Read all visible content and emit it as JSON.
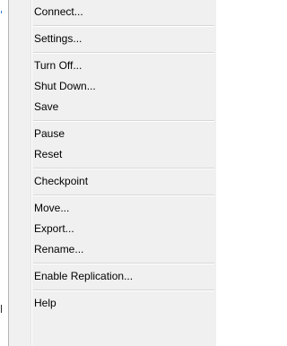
{
  "menu": {
    "groups": [
      [
        "Connect..."
      ],
      [
        "Settings..."
      ],
      [
        "Turn Off...",
        "Shut Down...",
        "Save"
      ],
      [
        "Pause",
        "Reset"
      ],
      [
        "Checkpoint"
      ],
      [
        "Move...",
        "Export...",
        "Rename..."
      ],
      [
        "Enable Replication..."
      ],
      [
        "Help"
      ]
    ],
    "items": {
      "connect": "Connect...",
      "settings": "Settings...",
      "turn_off": "Turn Off...",
      "shut_down": "Shut Down...",
      "save": "Save",
      "pause": "Pause",
      "reset": "Reset",
      "checkpoint": "Checkpoint",
      "move": "Move...",
      "export": "Export...",
      "rename": "Rename...",
      "enable_replication": "Enable Replication...",
      "help": "Help"
    }
  },
  "colors": {
    "menu_background": "#f0f0f0",
    "separator": "#d7d7d7",
    "text": "#000000"
  }
}
